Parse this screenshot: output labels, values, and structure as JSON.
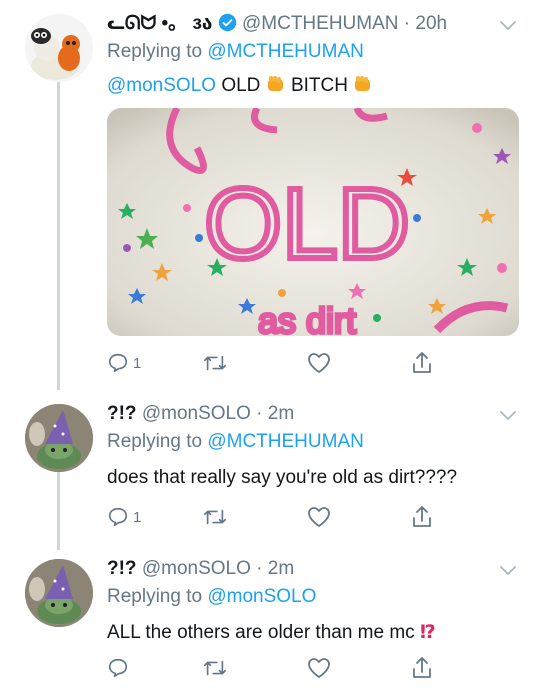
{
  "tweets": [
    {
      "display_name": "ᓚᘏᗢ •。 ɜა",
      "handle": "@MCTHEHUMAN",
      "time": "· 20h",
      "verified": true,
      "replying_label": "Replying to",
      "replying_to": "@MCTHEHUMAN",
      "body_mention": "@monSOLO",
      "body_word1": " OLD ",
      "body_word2": " BITCH ",
      "image_text": "OLD",
      "image_text_bottom": "as dirt",
      "reply_count": "1",
      "retweet_count": "",
      "like_count": ""
    },
    {
      "display_name": "?!?",
      "handle": "@monSOLO",
      "time": "· 2m",
      "replying_label": "Replying to",
      "replying_to": "@MCTHEHUMAN",
      "body": "does that really say you're old as dirt????",
      "reply_count": "1"
    },
    {
      "display_name": "?!?",
      "handle": "@monSOLO",
      "time": "· 2m",
      "replying_label": "Replying to",
      "replying_to": "@monSOLO",
      "body": "ALL the others are older than me mc",
      "body_emoji": "⁉",
      "reply_count": ""
    }
  ],
  "colors": {
    "link": "#1da1f2",
    "muted": "#657786",
    "line": "#ccd6dd"
  },
  "icons": [
    "reply-icon",
    "retweet-icon",
    "like-icon",
    "share-icon",
    "chevron-down-icon",
    "verified-badge-icon"
  ]
}
